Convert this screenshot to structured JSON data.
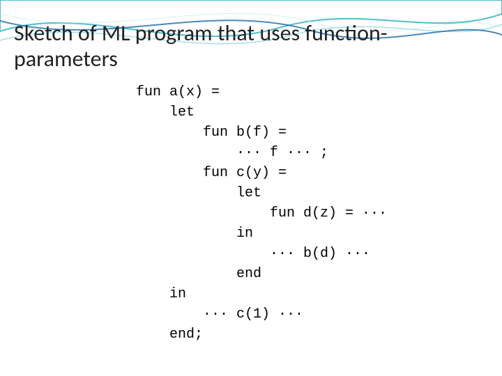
{
  "title": "Sketch of ML program that uses function-parameters",
  "code": {
    "l1": "fun a(x) =",
    "l2": "    let",
    "l3": "        fun b(f) =",
    "l4": "            ··· f ··· ;",
    "l5": "        fun c(y) =",
    "l6": "            let",
    "l7": "                fun d(z) = ···",
    "l8": "            in",
    "l9": "                ··· b(d) ···",
    "l10": "            end",
    "l11": "    in",
    "l12": "        ··· c(1) ···",
    "l13": "    end;"
  }
}
